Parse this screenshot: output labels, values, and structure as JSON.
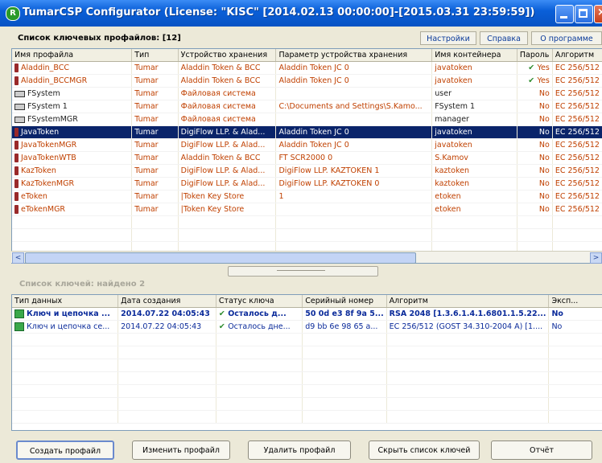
{
  "window": {
    "title": "TumarCSP Configurator (License: \"KISC\" [2014.02.13 00:00:00]-[2015.03.31 23:59:59])",
    "app_icon": "R"
  },
  "toolbar": {
    "profile_count": "Список ключевых профайлов: [12]",
    "buttons": [
      "Настройки",
      "Справка",
      "О программе"
    ]
  },
  "profiles": {
    "columns": [
      "Имя профайла",
      "Тип",
      "Устройство хранения",
      "Параметр устройства хранения",
      "Имя контейнера",
      "Пароль",
      "Алгоритм"
    ],
    "rows": [
      {
        "icon": "token-icon",
        "name": "Aladdin_BCC",
        "type": "Tumar",
        "device": "Aladdin Token & BCC",
        "param": "Aladdin Token JC 0",
        "container": "javatoken",
        "password": "Yes",
        "pw_check": true,
        "algo": "EC 256/512"
      },
      {
        "icon": "token-icon",
        "name": "Aladdin_BCCMGR",
        "type": "Tumar",
        "device": "Aladdin Token & BCC",
        "param": "Aladdin Token JC 0",
        "container": "javatoken",
        "password": "Yes",
        "pw_check": true,
        "algo": "EC 256/512"
      },
      {
        "icon": "filesystem-icon",
        "name": "FSystem",
        "type": "Tumar",
        "device": "Файловая система",
        "param": "",
        "container": "user",
        "password": "No",
        "pw_check": false,
        "algo": "EC 256/512"
      },
      {
        "icon": "filesystem-icon",
        "name": "FSystem 1",
        "type": "Tumar",
        "device": "Файловая система",
        "param": "C:\\Documents and Settings\\S.Kamo...",
        "container": "FSystem 1",
        "password": "No",
        "pw_check": false,
        "algo": "EC 256/512"
      },
      {
        "icon": "filesystem-icon",
        "name": "FSystemMGR",
        "type": "Tumar",
        "device": "Файловая система",
        "param": "",
        "container": "manager",
        "password": "No",
        "pw_check": false,
        "algo": "EC 256/512"
      },
      {
        "icon": "token-icon",
        "name": "JavaToken",
        "type": "Tumar",
        "device": "DigiFlow LLP. & Alad...",
        "param": "Aladdin Token JC 0",
        "container": "javatoken",
        "password": "No",
        "pw_check": false,
        "algo": "EC 256/512",
        "selected": true
      },
      {
        "icon": "token-icon",
        "name": "JavaTokenMGR",
        "type": "Tumar",
        "device": "DigiFlow LLP. & Alad...",
        "param": "Aladdin Token JC 0",
        "container": "javatoken",
        "password": "No",
        "pw_check": false,
        "algo": "EC 256/512"
      },
      {
        "icon": "token-icon",
        "name": "JavaTokenWTB",
        "type": "Tumar",
        "device": "Aladdin Token & BCC",
        "param": "FT SCR2000 0",
        "container": "S.Kamov",
        "password": "No",
        "pw_check": false,
        "algo": "EC 256/512"
      },
      {
        "icon": "token-icon",
        "name": "KazToken",
        "type": "Tumar",
        "device": "DigiFlow LLP. & Alad...",
        "param": "DigiFlow LLP. KAZTOKEN 1",
        "container": "kaztoken",
        "password": "No",
        "pw_check": false,
        "algo": "EC 256/512"
      },
      {
        "icon": "token-icon",
        "name": "KazTokenMGR",
        "type": "Tumar",
        "device": "DigiFlow LLP. & Alad...",
        "param": "DigiFlow LLP. KAZTOKEN 0",
        "container": "kaztoken",
        "password": "No",
        "pw_check": false,
        "algo": "EC 256/512"
      },
      {
        "icon": "token-icon",
        "name": "eToken",
        "type": "Tumar",
        "device": "|Token Key Store",
        "param": "1",
        "container": "etoken",
        "password": "No",
        "pw_check": false,
        "algo": "EC 256/512"
      },
      {
        "icon": "token-icon",
        "name": "eTokenMGR",
        "type": "Tumar",
        "device": "|Token Key Store",
        "param": "",
        "container": "etoken",
        "password": "No",
        "pw_check": false,
        "algo": "EC 256/512"
      }
    ]
  },
  "keys": {
    "label": "Список ключей: найдено 2",
    "columns": [
      "Тип данных",
      "Дата создания",
      "Статус ключа",
      "Серийный номер",
      "Алгоритм",
      "Эксп..."
    ],
    "rows": [
      {
        "type": "Ключ и цепочка ...",
        "date": "2014.07.22 04:05:43",
        "status": "Осталось д...",
        "serial": "50 0d e3 8f 9a 5...",
        "algo": "RSA 2048 [1.3.6.1.4.1.6801.1.5.22...",
        "exp": "No",
        "bold": true
      },
      {
        "type": "Ключ и цепочка се...",
        "date": "2014.07.22 04:05:43",
        "status": "Осталось дне...",
        "serial": "d9 bb 6e 98 65 a...",
        "algo": "EC 256/512 (GOST 34.310-2004 A) [1....",
        "exp": "No",
        "bold": false
      }
    ]
  },
  "actions": [
    "Создать профайл",
    "Изменить профайл",
    "Удалить профайл",
    "Скрыть список ключей",
    "Отчёт"
  ]
}
